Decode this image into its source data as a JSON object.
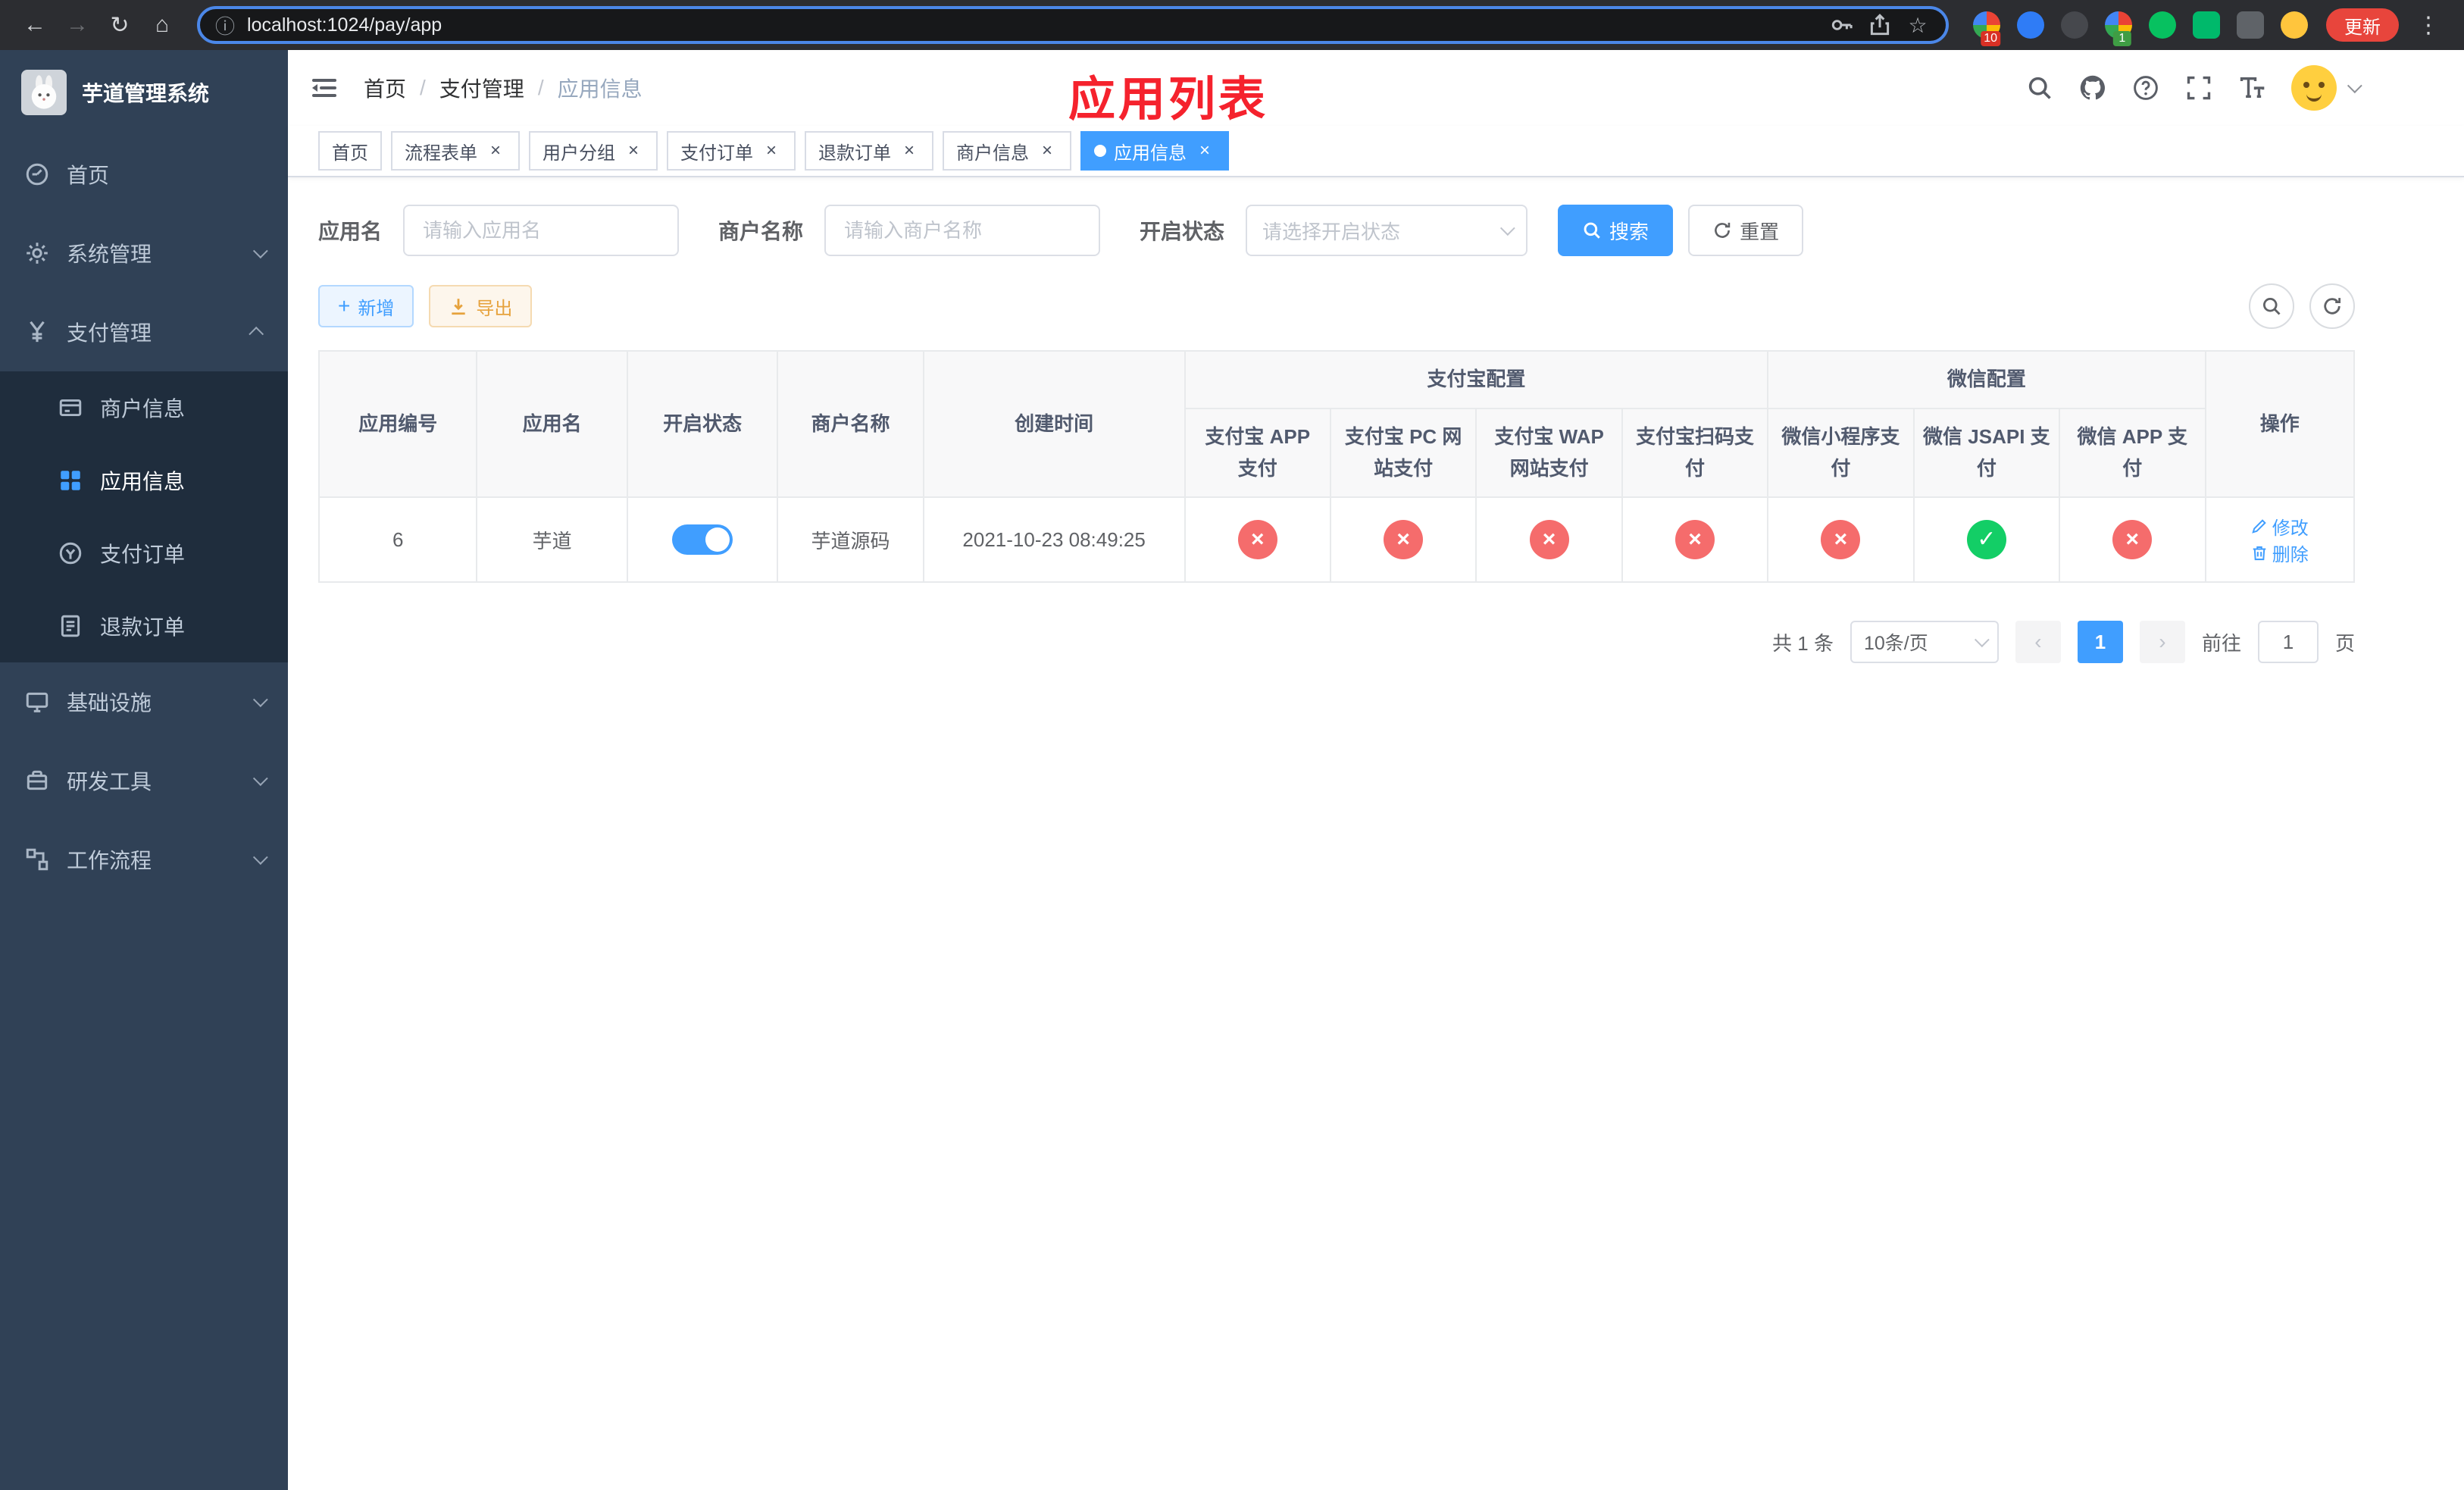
{
  "browser": {
    "url": "localhost:1024/pay/app",
    "update_label": "更新",
    "extensions": [
      {
        "key": "colorful-grid",
        "color": "#4285f4",
        "shape": "conic",
        "badge": "10",
        "badge_color": "#d93025"
      },
      {
        "key": "blue-drop",
        "color": "#2f7cf6",
        "shape": "circle"
      },
      {
        "key": "dark-shield",
        "color": "#46484d",
        "shape": "circle"
      },
      {
        "key": "colorful-tool",
        "color": "#e8710a",
        "shape": "conic",
        "badge": "1",
        "badge_color": "#3f9d44"
      },
      {
        "key": "wechat-devtools",
        "color": "#07c160",
        "shape": "circle"
      },
      {
        "key": "green-notebook",
        "color": "#00b96b",
        "shape": "square"
      },
      {
        "key": "dark-pin",
        "color": "#5f6368",
        "shape": "square"
      },
      {
        "key": "emoji-face",
        "color": "#ffc53d",
        "shape": "circle"
      }
    ]
  },
  "sidebar": {
    "logo_title": "芋道管理系统",
    "items": [
      {
        "key": "home",
        "label": "首页",
        "icon": "dashboard-icon",
        "type": "item"
      },
      {
        "key": "system-management",
        "label": "系统管理",
        "icon": "gear-icon",
        "type": "group",
        "chevron": "down"
      },
      {
        "key": "payment-management",
        "label": "支付管理",
        "icon": "yen-icon",
        "type": "group",
        "chevron": "up"
      },
      {
        "key": "merchant-info",
        "label": "商户信息",
        "icon": "card-icon",
        "type": "subitem"
      },
      {
        "key": "app-info",
        "label": "应用信息",
        "icon": "grid-icon",
        "type": "subitem",
        "active": true
      },
      {
        "key": "payment-orders",
        "label": "支付订单",
        "icon": "order-icon",
        "type": "subitem"
      },
      {
        "key": "refund-orders",
        "label": "退款订单",
        "icon": "doc-icon",
        "type": "subitem"
      },
      {
        "key": "infrastructure",
        "label": "基础设施",
        "icon": "infra-icon",
        "type": "group",
        "chevron": "down"
      },
      {
        "key": "dev-tools",
        "label": "研发工具",
        "icon": "tools-icon",
        "type": "group",
        "chevron": "down"
      },
      {
        "key": "workflow",
        "label": "工作流程",
        "icon": "flow-icon",
        "type": "group",
        "chevron": "down"
      }
    ]
  },
  "header": {
    "breadcrumb": [
      "首页",
      "支付管理",
      "应用信息"
    ],
    "annotation": "应用列表"
  },
  "tabs": [
    {
      "key": "home",
      "label": "首页",
      "closable": false
    },
    {
      "key": "process-form",
      "label": "流程表单",
      "closable": true
    },
    {
      "key": "user-group",
      "label": "用户分组",
      "closable": true
    },
    {
      "key": "payment-orders",
      "label": "支付订单",
      "closable": true
    },
    {
      "key": "refund-orders",
      "label": "退款订单",
      "closable": true
    },
    {
      "key": "merchant-info",
      "label": "商户信息",
      "closable": true
    },
    {
      "key": "app-info",
      "label": "应用信息",
      "closable": true,
      "active": true
    }
  ],
  "filters": {
    "app_name_label": "应用名",
    "app_name_placeholder": "请输入应用名",
    "merchant_label": "商户名称",
    "merchant_placeholder": "请输入商户名称",
    "status_label": "开启状态",
    "status_placeholder": "请选择开启状态",
    "search_button": "搜索",
    "reset_button": "重置"
  },
  "toolbar": {
    "add_button": "新增",
    "export_button": "导出"
  },
  "table": {
    "base_columns": [
      "应用编号",
      "应用名",
      "开启状态",
      "商户名称",
      "创建时间"
    ],
    "alipay_group": "支付宝配置",
    "alipay_columns": [
      "支付宝 APP 支付",
      "支付宝 PC 网站支付",
      "支付宝 WAP 网站支付",
      "支付宝扫码支付"
    ],
    "wechat_group": "微信配置",
    "wechat_columns": [
      "微信小程序支付",
      "微信 JSAPI 支付",
      "微信 APP 支付"
    ],
    "ops_column": "操作",
    "rows": [
      {
        "id": "6",
        "name": "芋道",
        "enabled": true,
        "merchant": "芋道源码",
        "created": "2021-10-23 08:49:25",
        "configs": [
          false,
          false,
          false,
          false,
          false,
          true,
          false
        ],
        "edit_label": "修改",
        "delete_label": "删除"
      }
    ]
  },
  "pagination": {
    "total_text": "共 1 条",
    "page_size_text": "10条/页",
    "current_page": "1",
    "goto_label": "前往",
    "goto_value": "1",
    "goto_suffix": "页"
  },
  "colors": {
    "accent": "#409eff",
    "danger": "#f56c6c",
    "success": "#13ce66",
    "warning": "#e6a23c",
    "annotation_red": "#f5222d",
    "sidebar_bg": "#304156",
    "submenu_bg": "#1f2d3d"
  }
}
